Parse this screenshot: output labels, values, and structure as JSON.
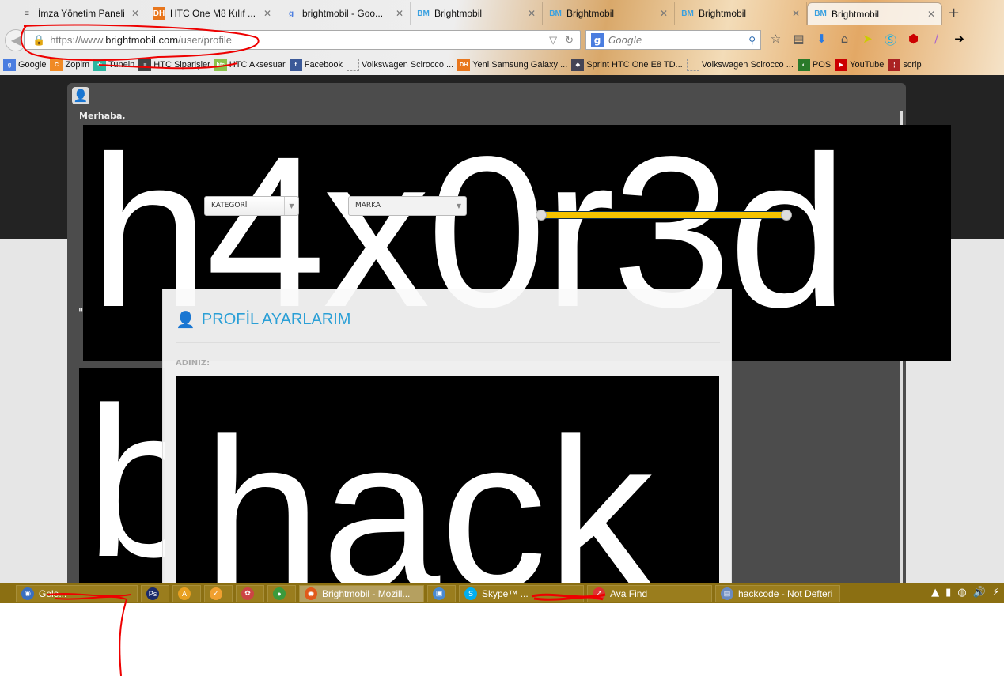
{
  "browser": {
    "tabs": [
      {
        "icon": "≡",
        "label": "İmza Yönetim Paneli",
        "color": "#444"
      },
      {
        "icon": "DH",
        "label": "HTC One M8 Kılıf ...",
        "color": "#e8761c"
      },
      {
        "icon": "g",
        "label": "brightmobil - Goo...",
        "color": "#4a7de0"
      },
      {
        "icon": "BM",
        "label": "Brightmobil",
        "color": "#39a0e0"
      },
      {
        "icon": "BM",
        "label": "Brightmobil",
        "color": "#39a0e0"
      },
      {
        "icon": "BM",
        "label": "Brightmobil",
        "color": "#39a0e0"
      },
      {
        "icon": "BM",
        "label": "Brightmobil",
        "color": "#39a0e0"
      }
    ],
    "url_host_prefix": "https://www.",
    "url_host": "brightmobil.com",
    "url_path": "/user/profile",
    "search_placeholder": "Google",
    "bookmarks": [
      {
        "icon": "g",
        "label": "Google",
        "color": "#4a7de0"
      },
      {
        "icon": "C",
        "label": "Zopim",
        "color": "#f08a24"
      },
      {
        "icon": "✚",
        "label": "Tunein",
        "color": "#2bb5a0"
      },
      {
        "icon": "≡",
        "label": "HTC Siparişler",
        "color": "#444"
      },
      {
        "icon": "htc",
        "label": "HTC Aksesuar",
        "color": "#8bc34a"
      },
      {
        "icon": "f",
        "label": "Facebook",
        "color": "#3b5998"
      },
      {
        "icon": "",
        "label": "Volkswagen Scirocco ...",
        "color": "#ccc"
      },
      {
        "icon": "DH",
        "label": "Yeni Samsung Galaxy ...",
        "color": "#e8761c"
      },
      {
        "icon": "◆",
        "label": "Sprint HTC One E8 TD...",
        "color": "#445"
      },
      {
        "icon": "",
        "label": "Volkswagen Scirocco ...",
        "color": "#ccc"
      },
      {
        "icon": "◐",
        "label": "POS",
        "color": "#2a7a2a"
      },
      {
        "icon": "▶",
        "label": "YouTube",
        "color": "#c00"
      },
      {
        "icon": "¦",
        "label": "scrip",
        "color": "#a22"
      }
    ]
  },
  "page": {
    "greeting": "Merhaba,",
    "quote": "\"",
    "deface_text": "h4x0r3d",
    "category_select": "KATEGORİ",
    "brand_select": "MARKA",
    "side_text": "b",
    "slider_range": [
      0,
      100
    ],
    "profile": {
      "title": "PROFİL AYARLARIM",
      "name_label": "ADINIZ:",
      "name_value": "hack"
    }
  },
  "taskbar": {
    "items": [
      {
        "label": "Gele...",
        "icon": "◉",
        "color": "#3a6fc0",
        "width": 154
      },
      {
        "label": "",
        "icon": "Ps",
        "color": "#1a2a6a",
        "width": 36
      },
      {
        "label": "",
        "icon": "A",
        "color": "#e8a020",
        "width": 36
      },
      {
        "label": "",
        "icon": "✓",
        "color": "#f0a030",
        "width": 36
      },
      {
        "label": "",
        "icon": "✿",
        "color": "#c44",
        "width": 36
      },
      {
        "label": "",
        "icon": "●",
        "color": "#3c9a3c",
        "width": 36
      },
      {
        "label": "Brightmobil - Mozill...",
        "icon": "◉",
        "color": "#e05a1a",
        "width": 158,
        "active": true
      },
      {
        "label": "",
        "icon": "▣",
        "color": "#4a8ad0",
        "width": 36
      },
      {
        "label": "Skype™ ...",
        "icon": "S",
        "color": "#00aff0",
        "width": 158
      },
      {
        "label": "Ava Find",
        "icon": "↗",
        "color": "#d33",
        "width": 158
      },
      {
        "label": "hackcode - Not Defteri",
        "icon": "▤",
        "color": "#6a8ac0",
        "width": 158
      }
    ],
    "tray": [
      "▲",
      "▮",
      "◍",
      "🔊",
      "⚡"
    ]
  }
}
